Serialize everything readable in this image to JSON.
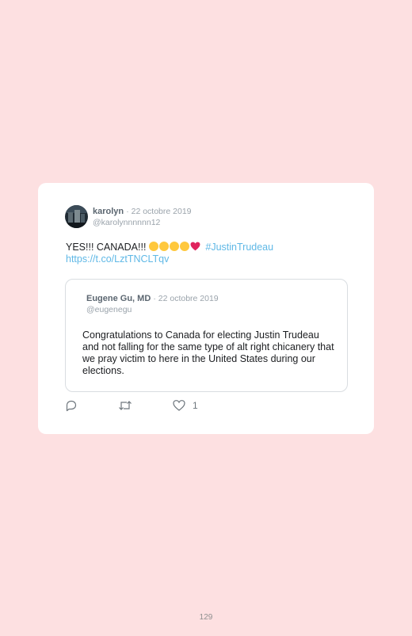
{
  "tweet": {
    "author_name": "karolyn",
    "date": "· 22 octobre 2019",
    "handle": "@karolynnnnnn12",
    "text": "YES!!! CANADA!!!",
    "emojis": [
      "smiling-face-icon",
      "hugging-face-icon",
      "grinning-face-icon",
      "slightly-smiling-face-icon",
      "red-heart-icon"
    ],
    "hashtag": "#JustinTrudeau",
    "link": "https://t.co/LztTNCLTqv"
  },
  "quoted": {
    "author_name": "Eugene Gu, MD",
    "date": "· 22 octobre 2019",
    "handle": "@eugenegu",
    "text": "Congratulations to Canada for electing Justin Trudeau and not falling for the same type of alt right chicanery that we pray victim to here in the United States during our elections."
  },
  "actions": {
    "reply_icon": "reply-icon",
    "retweet_icon": "retweet-icon",
    "like_icon": "heart-icon",
    "like_count": "1"
  },
  "page_number": "129",
  "colors": {
    "background": "#fde0e1",
    "card": "#ffffff",
    "link": "#5fb8e6",
    "muted": "#9aa3ab"
  }
}
